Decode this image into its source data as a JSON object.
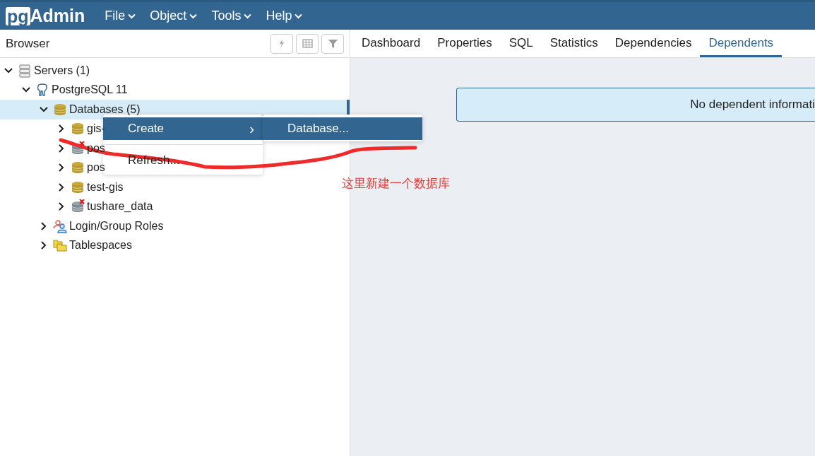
{
  "app": {
    "logo_left": "pg",
    "logo_right": "Admin"
  },
  "menu": [
    {
      "label": "File"
    },
    {
      "label": "Object"
    },
    {
      "label": "Tools"
    },
    {
      "label": "Help"
    }
  ],
  "browser": {
    "title": "Browser",
    "toolbar": [
      {
        "kind": "query"
      },
      {
        "kind": "table"
      },
      {
        "kind": "filter"
      }
    ]
  },
  "tree": [
    {
      "label": "Servers (1)",
      "kind": "server",
      "expanded": true,
      "selected": false,
      "children": [
        {
          "label": "PostgreSQL 11",
          "kind": "elephant",
          "expanded": true,
          "selected": false,
          "children": [
            {
              "label": "Databases (5)",
              "kind": "database",
              "expanded": true,
              "selected": true,
              "children": [
                {
                  "label": "gis-",
                  "kind": "database",
                  "expanded": false,
                  "selected": false
                },
                {
                  "label": "pos",
                  "kind": "offline",
                  "expanded": false,
                  "selected": false
                },
                {
                  "label": "pos",
                  "kind": "database",
                  "expanded": false,
                  "selected": false
                },
                {
                  "label": "test-gis",
                  "kind": "database",
                  "expanded": false,
                  "selected": false
                },
                {
                  "label": "tushare_data",
                  "kind": "offline",
                  "expanded": false,
                  "selected": false
                }
              ]
            },
            {
              "label": "Login/Group Roles",
              "kind": "roles",
              "expanded": false,
              "selected": false
            },
            {
              "label": "Tablespaces",
              "kind": "tablespace",
              "expanded": false,
              "selected": false
            }
          ]
        }
      ]
    }
  ],
  "tabs": [
    {
      "label": "Dashboard",
      "selected": false
    },
    {
      "label": "Properties",
      "selected": false
    },
    {
      "label": "SQL",
      "selected": false
    },
    {
      "label": "Statistics",
      "selected": false
    },
    {
      "label": "Dependencies",
      "selected": false
    },
    {
      "label": "Dependents",
      "selected": true
    }
  ],
  "message": "No dependent informati",
  "context_menu": {
    "items": [
      {
        "label": "Create",
        "submenu_arrow": "›",
        "selected": true
      },
      {
        "label": "Refresh...",
        "selected": false
      }
    ],
    "submenu": [
      {
        "label": "Database...",
        "selected": true
      }
    ]
  },
  "annotation": {
    "text": "这里新建一个数据库"
  }
}
